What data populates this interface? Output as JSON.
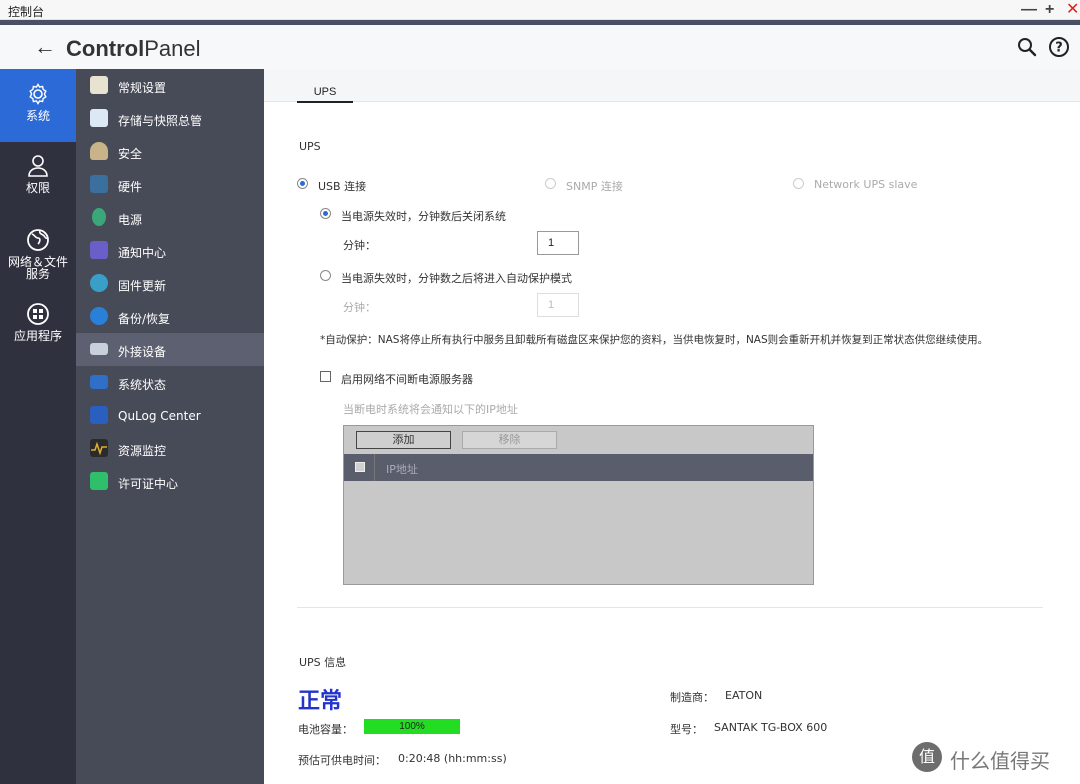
{
  "window": {
    "title": "控制台",
    "minimize": "—",
    "maximize": "+",
    "close": "✕"
  },
  "header": {
    "back_icon": "arrow-left-icon",
    "title_bold": "Control",
    "title_light": "Panel",
    "search_icon": "search-icon",
    "help_icon": "help-icon"
  },
  "leftnav": {
    "items": [
      {
        "label": "系统",
        "icon": "gear-icon",
        "active": true
      },
      {
        "label": "权限",
        "icon": "user-icon",
        "active": false
      },
      {
        "label": "网络＆文件服务",
        "label_line1": "网络＆文件",
        "label_line2": "服务",
        "icon": "globe-icon",
        "active": false
      },
      {
        "label": "应用程序",
        "icon": "apps-icon",
        "active": false
      }
    ]
  },
  "subnav": {
    "items": [
      {
        "label": "常规设置",
        "icon": "settings-doc-icon"
      },
      {
        "label": "存储与快照总管",
        "icon": "storage-icon"
      },
      {
        "label": "安全",
        "icon": "lock-icon"
      },
      {
        "label": "硬件",
        "icon": "hardware-icon"
      },
      {
        "label": "电源",
        "icon": "power-icon"
      },
      {
        "label": "通知中心",
        "icon": "notification-icon"
      },
      {
        "label": "固件更新",
        "icon": "firmware-icon"
      },
      {
        "label": "备份/恢复",
        "icon": "backup-icon"
      },
      {
        "label": "外接设备",
        "icon": "external-device-icon",
        "active": true
      },
      {
        "label": "系统状态",
        "icon": "system-status-icon"
      },
      {
        "label": "QuLog Center",
        "icon": "qulog-icon"
      },
      {
        "label": "资源监控",
        "icon": "resource-monitor-icon"
      },
      {
        "label": "许可证中心",
        "icon": "license-icon"
      }
    ]
  },
  "tabs": [
    {
      "label": "UPS",
      "active": true
    }
  ],
  "ups": {
    "section_title": "UPS",
    "modes": [
      {
        "label": "USB 连接",
        "selected": true
      },
      {
        "label": "SNMP 连接",
        "selected": false,
        "disabled": true
      },
      {
        "label": "Network UPS slave",
        "selected": false,
        "disabled": true
      }
    ],
    "option_shutdown": "当电源失效时，分钟数后关闭系统",
    "minutes_label": "分钟：",
    "shutdown_minutes": "1",
    "option_protect": "当电源失效时，分钟数之后将进入自动保护模式",
    "protect_minutes_label": "分钟：",
    "protect_minutes": "1",
    "note": "*自动保护：NAS将停止所有执行中服务且卸载所有磁盘区来保护您的资料，当供电恢复时，NAS则会重新开机并恢复到正常状态供您继续使用。",
    "network_server_label": "启用网络不间断电源服务器",
    "network_server_hint": "当断电时系统将会通知以下的IP地址",
    "add_button": "添加",
    "remove_button": "移除",
    "ip_column": "IP地址"
  },
  "ups_info": {
    "section_title": "UPS 信息",
    "status": "正常",
    "battery_label": "电池容量：",
    "battery_percent": 100,
    "battery_text": "100%",
    "runtime_label": "预估可供电时间：",
    "runtime_value": "0:20:48 (hh:mm:ss)",
    "manufacturer_label": "制造商：",
    "manufacturer_value": "EATON",
    "model_label": "型号：",
    "model_value": "SANTAK TG-BOX 600"
  },
  "watermark": {
    "logo": "值",
    "text": "什么值得买"
  },
  "colors": {
    "accent": "#2c6ad8",
    "leftnav_bg": "#2f313f",
    "subnav_bg": "#474a57",
    "status_blue": "#2233cc",
    "battery_green": "#22dd22"
  }
}
